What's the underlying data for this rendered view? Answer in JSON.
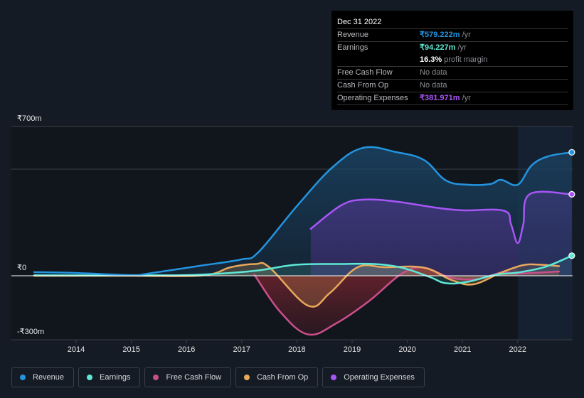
{
  "tooltip": {
    "date": "Dec 31 2022",
    "rows": [
      {
        "label": "Revenue",
        "value": "₹579.222m",
        "suffix": " /yr",
        "color": "#2394df"
      },
      {
        "label": "Earnings",
        "value": "₹94.227m",
        "suffix": " /yr",
        "color": "#5ee8d5"
      },
      {
        "label": "",
        "value": "16.3%",
        "suffix": " profit margin",
        "color": "#ffffff"
      },
      {
        "label": "Free Cash Flow",
        "value": "",
        "suffix": "No data",
        "color": "#8a8d92"
      },
      {
        "label": "Cash From Op",
        "value": "",
        "suffix": "No data",
        "color": "#8a8d92"
      },
      {
        "label": "Operating Expenses",
        "value": "₹381.971m",
        "suffix": " /yr",
        "color": "#a855f7"
      }
    ]
  },
  "legend": [
    {
      "label": "Revenue",
      "color": "#2394df"
    },
    {
      "label": "Earnings",
      "color": "#5ee8d5"
    },
    {
      "label": "Free Cash Flow",
      "color": "#c94f8b"
    },
    {
      "label": "Cash From Op",
      "color": "#e8a95b"
    },
    {
      "label": "Operating Expenses",
      "color": "#a855f7"
    }
  ],
  "chart_data": {
    "type": "area",
    "title": "",
    "xlabel": "",
    "ylabel": "",
    "y_tick_labels": [
      "₹700m",
      "₹0",
      "-₹300m"
    ],
    "y_ticks": [
      700,
      0,
      -300
    ],
    "ylim": [
      -300,
      700
    ],
    "xlim": [
      2013.0,
      2022.98
    ],
    "x_tick_labels": [
      "2014",
      "2015",
      "2016",
      "2017",
      "2018",
      "2019",
      "2020",
      "2021",
      "2022"
    ],
    "x_ticks": [
      2014,
      2015,
      2016,
      2017,
      2018,
      2019,
      2020,
      2021,
      2022
    ],
    "gridlines": [
      700,
      500
    ],
    "highlight_from": 2022.0,
    "series": [
      {
        "name": "Revenue",
        "color": "#2394df",
        "x": [
          2013.24,
          2014.0,
          2015.0,
          2015.3,
          2016.25,
          2017.0,
          2017.3,
          2018.0,
          2018.65,
          2019.2,
          2019.8,
          2020.3,
          2020.7,
          2021.1,
          2021.5,
          2021.7,
          2022.0,
          2022.25,
          2022.55,
          2022.98
        ],
        "y": [
          17,
          13,
          3,
          10,
          47,
          77,
          110,
          327,
          510,
          600,
          580,
          543,
          447,
          427,
          430,
          450,
          427,
          517,
          560,
          579
        ]
      },
      {
        "name": "Earnings",
        "color": "#5ee8d5",
        "x": [
          2013.24,
          2015.0,
          2016.0,
          2016.6,
          2017.3,
          2018.0,
          2018.8,
          2019.4,
          2019.9,
          2020.4,
          2020.7,
          2021.1,
          2021.6,
          2022.0,
          2022.5,
          2022.98
        ],
        "y": [
          2,
          2,
          3,
          10,
          25,
          52,
          55,
          55,
          38,
          -5,
          -35,
          -28,
          5,
          15,
          42,
          94
        ]
      },
      {
        "name": "Free Cash Flow",
        "color": "#c94f8b",
        "x": [
          2017.23,
          2017.7,
          2018.2,
          2018.7,
          2019.3,
          2019.9,
          2020.3,
          2020.8,
          2021.3,
          2021.7,
          2022.0,
          2022.4,
          2022.75
        ],
        "y": [
          5,
          -170,
          -275,
          -225,
          -120,
          10,
          38,
          -10,
          -15,
          15,
          10,
          15,
          20
        ]
      },
      {
        "name": "Cash From Op",
        "color": "#e8a95b",
        "x": [
          2013.24,
          2015.0,
          2016.3,
          2016.8,
          2017.25,
          2017.5,
          2018.2,
          2018.6,
          2019.1,
          2019.6,
          2020.3,
          2020.8,
          2021.2,
          2021.7,
          2022.1,
          2022.4,
          2022.75
        ],
        "y": [
          0,
          0,
          2,
          40,
          55,
          40,
          -140,
          -80,
          40,
          40,
          38,
          -20,
          -40,
          15,
          50,
          52,
          45
        ]
      },
      {
        "name": "Operating Expenses",
        "color": "#a855f7",
        "x": [
          2018.25,
          2018.8,
          2019.2,
          2019.8,
          2020.5,
          2021.0,
          2021.75,
          2021.88,
          2022.0,
          2022.1,
          2022.22,
          2022.98
        ],
        "y": [
          220,
          330,
          357,
          348,
          320,
          307,
          305,
          240,
          153,
          240,
          383,
          382
        ]
      }
    ]
  }
}
